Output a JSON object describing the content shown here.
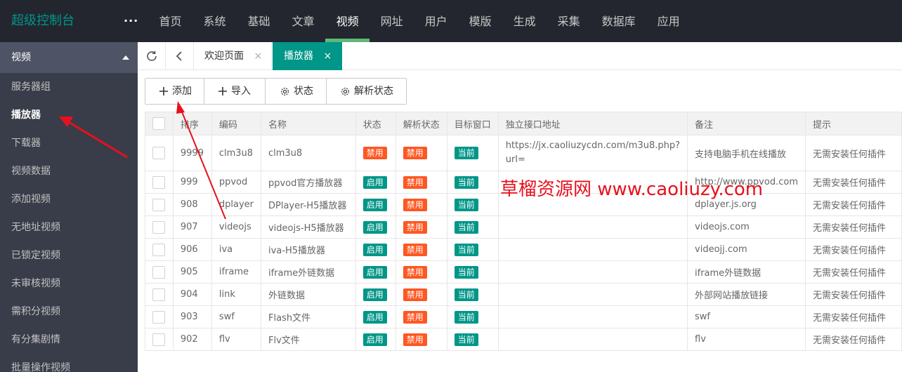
{
  "header": {
    "brand": "超级控制台",
    "more": "···",
    "nav": [
      "首页",
      "系统",
      "基础",
      "文章",
      "视频",
      "网址",
      "用户",
      "模版",
      "生成",
      "采集",
      "数据库",
      "应用"
    ],
    "active_nav_index": 4
  },
  "sidebar": {
    "section": "视频",
    "items": [
      "服务器组",
      "播放器",
      "下载器",
      "视频数据",
      "添加视频",
      "无地址视频",
      "已锁定视频",
      "未审核视频",
      "需积分视频",
      "有分集剧情",
      "批量操作视频"
    ],
    "active_index": 1
  },
  "tabs": {
    "items": [
      {
        "label": "欢迎页面",
        "close": "×"
      },
      {
        "label": "播放器",
        "close": "×"
      }
    ],
    "active_index": 1
  },
  "toolbar": {
    "add": "添加",
    "import": "导入",
    "status": "状态",
    "parse_status": "解析状态"
  },
  "table": {
    "headers": [
      "排序",
      "编码",
      "名称",
      "状态",
      "解析状态",
      "目标窗口",
      "独立接口地址",
      "备注",
      "提示"
    ],
    "rows": [
      {
        "sort": "9999",
        "code": "clm3u8",
        "name": "clm3u8",
        "status": "禁用",
        "parse": "禁用",
        "target": "当前",
        "url": "https://jx.caoliuzycdn.com/m3u8.php?url=",
        "note": "支持电脑手机在线播放",
        "tip": "无需安装任何插件"
      },
      {
        "sort": "999",
        "code": "ppvod",
        "name": "ppvod官方播放器",
        "status": "启用",
        "parse": "禁用",
        "target": "当前",
        "url": "",
        "note": "http://www.ppvod.com",
        "tip": "无需安装任何插件"
      },
      {
        "sort": "908",
        "code": "dplayer",
        "name": "DPlayer-H5播放器",
        "status": "启用",
        "parse": "禁用",
        "target": "当前",
        "url": "",
        "note": "dplayer.js.org",
        "tip": "无需安装任何插件"
      },
      {
        "sort": "907",
        "code": "videojs",
        "name": "videojs-H5播放器",
        "status": "启用",
        "parse": "禁用",
        "target": "当前",
        "url": "",
        "note": "videojs.com",
        "tip": "无需安装任何插件"
      },
      {
        "sort": "906",
        "code": "iva",
        "name": "iva-H5播放器",
        "status": "启用",
        "parse": "禁用",
        "target": "当前",
        "url": "",
        "note": "videojj.com",
        "tip": "无需安装任何插件"
      },
      {
        "sort": "905",
        "code": "iframe",
        "name": "iframe外链数据",
        "status": "启用",
        "parse": "禁用",
        "target": "当前",
        "url": "",
        "note": "iframe外链数据",
        "tip": "无需安装任何插件"
      },
      {
        "sort": "904",
        "code": "link",
        "name": "外链数据",
        "status": "启用",
        "parse": "禁用",
        "target": "当前",
        "url": "",
        "note": "外部网站播放链接",
        "tip": "无需安装任何插件"
      },
      {
        "sort": "903",
        "code": "swf",
        "name": "Flash文件",
        "status": "启用",
        "parse": "禁用",
        "target": "当前",
        "url": "",
        "note": "swf",
        "tip": "无需安装任何插件"
      },
      {
        "sort": "902",
        "code": "flv",
        "name": "Flv文件",
        "status": "启用",
        "parse": "禁用",
        "target": "当前",
        "url": "",
        "note": "flv",
        "tip": "无需安装任何插件"
      }
    ]
  },
  "watermark": "草榴资源网  www.caoliuzy.com",
  "colors": {
    "topbar": "#23262e",
    "sidebar": "#393d49",
    "brand": "#009688",
    "nav_active_underline": "#5fb878",
    "badge_disabled": "#ff5722",
    "badge_enabled": "#009688",
    "annotation": "#e8101e"
  }
}
